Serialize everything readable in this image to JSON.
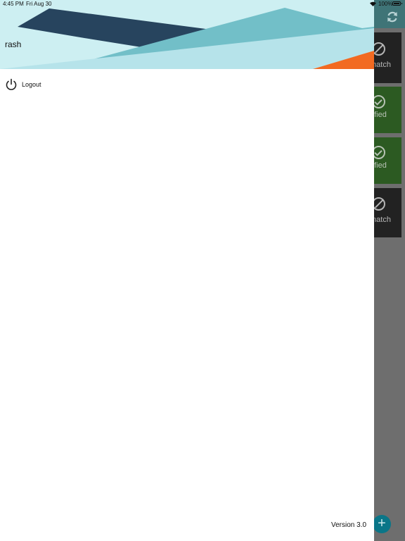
{
  "status_bar": {
    "time": "4:45 PM",
    "date": "Fri Aug 30",
    "battery": "100%"
  },
  "drawer": {
    "user_name": "rash",
    "menu": [
      {
        "label": "Logout",
        "icon": "power-icon"
      }
    ],
    "version": "Version 3.0"
  },
  "background_app": {
    "cards": [
      {
        "label": "match",
        "status": "mismatch",
        "color": "#222222"
      },
      {
        "label": "rified",
        "status": "verified",
        "color": "#2c5a22"
      },
      {
        "label": "rified",
        "status": "verified",
        "color": "#2c5a22"
      },
      {
        "label": "match",
        "status": "mismatch",
        "color": "#222222"
      }
    ],
    "fab_symbol": "+"
  },
  "colors": {
    "header_light": "#cdeff2",
    "header_navy": "#27445e",
    "header_teal": "#72bfc8",
    "header_orange": "#f26a21",
    "fab": "#0a7688"
  }
}
